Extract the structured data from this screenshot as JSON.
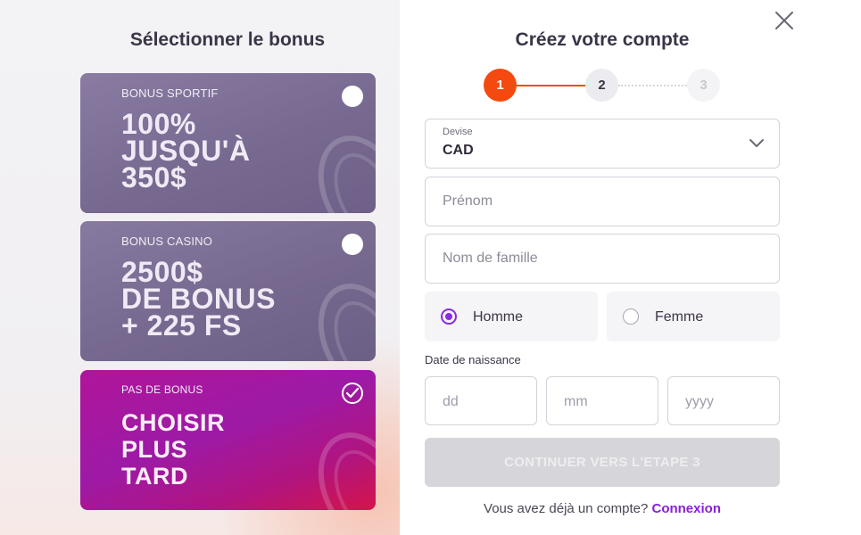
{
  "bonus": {
    "title": "Sélectionner le bonus",
    "cards": [
      {
        "label": "BONUS SPORTIF",
        "headline": "100%\nJUSQU'À\n350$",
        "selected": false
      },
      {
        "label": "BONUS CASINO",
        "headline": "2500$\nDE BONUS\n+ 225 FS",
        "selected": false
      },
      {
        "label": "PAS DE BONUS",
        "headline": "CHOISIR\nPLUS\nTARD",
        "selected": true
      }
    ]
  },
  "form": {
    "title": "Créez votre compte",
    "steps": [
      "1",
      "2",
      "3"
    ],
    "current_step": 1,
    "currency": {
      "label": "Devise",
      "value": "CAD"
    },
    "first_name": {
      "placeholder": "Prénom"
    },
    "last_name": {
      "placeholder": "Nom de famille"
    },
    "gender": {
      "options": [
        "Homme",
        "Femme"
      ],
      "selected": "Homme"
    },
    "dob": {
      "label": "Date de naissance",
      "day": "dd",
      "month": "mm",
      "year": "yyyy"
    },
    "continue_label": "CONTINUER VERS L'ETAPE 3",
    "login_prompt": "Vous avez déjà un compte?",
    "login_link": "Connexion"
  },
  "colors": {
    "accent": "#f44a0f",
    "purple": "#8a1fd6",
    "magenta": "#b0159a"
  },
  "icons": {
    "close": "close-icon",
    "chevron": "chevron-down-icon",
    "check": "check-icon"
  }
}
